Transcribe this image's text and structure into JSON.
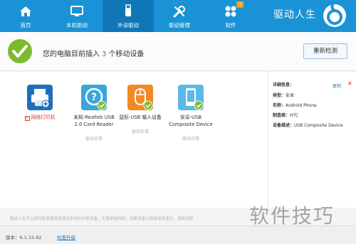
{
  "nav": {
    "items": [
      {
        "label": "首页",
        "icon": "home-icon"
      },
      {
        "label": "本机驱动",
        "icon": "monitor-icon"
      },
      {
        "label": "外设驱动",
        "icon": "usb-icon"
      },
      {
        "label": "驱动管理",
        "icon": "wrench-icon"
      },
      {
        "label": "软件",
        "icon": "apps-icon",
        "badge": "3"
      }
    ],
    "active": "外设驱动",
    "brand": "驱动人生"
  },
  "status": {
    "prefix": "您的电脑目前插入",
    "count": "3",
    "suffix": "个移动设备",
    "rescan_label": "重新检测"
  },
  "devices": [
    {
      "name": "网络打印机",
      "state": "",
      "icon": "printer-icon"
    },
    {
      "name_line1": "未知-Realtek USB",
      "name_line2": "2.0 Card Reader",
      "state": "驱动正常",
      "icon": "unknown-device-icon"
    },
    {
      "name_line1": "鼠标-USB 输入设备",
      "name_line2": "",
      "state": "驱动正常",
      "icon": "mouse-icon"
    },
    {
      "name_line1": "安卓-USB",
      "name_line2": "Composite Device",
      "state": "驱动正常",
      "icon": "android-phone-icon"
    }
  ],
  "detail": {
    "header": "详细信息：",
    "copy_label": "复制",
    "close_label": "✕",
    "rows": [
      {
        "key": "类型：",
        "value": "安卓"
      },
      {
        "key": "名称：",
        "value": "Android Phone"
      },
      {
        "key": "制造商：",
        "value": "HTC"
      },
      {
        "key": "设备描述：",
        "value": "USB Composite Device"
      }
    ]
  },
  "note": "驱动人生可以实时检测直接连接至本机的外部设备，无需单独添加；如果设备已连接却未显示，请尝试断",
  "footer": {
    "version": "版本：6.1.15.82",
    "upgrade": "检查升级"
  },
  "watermark": "软件技巧",
  "colors": {
    "accent": "#1a93d6",
    "active_tab": "#0f77b8",
    "success": "#7dbb2e",
    "warning": "#e63c2e"
  }
}
